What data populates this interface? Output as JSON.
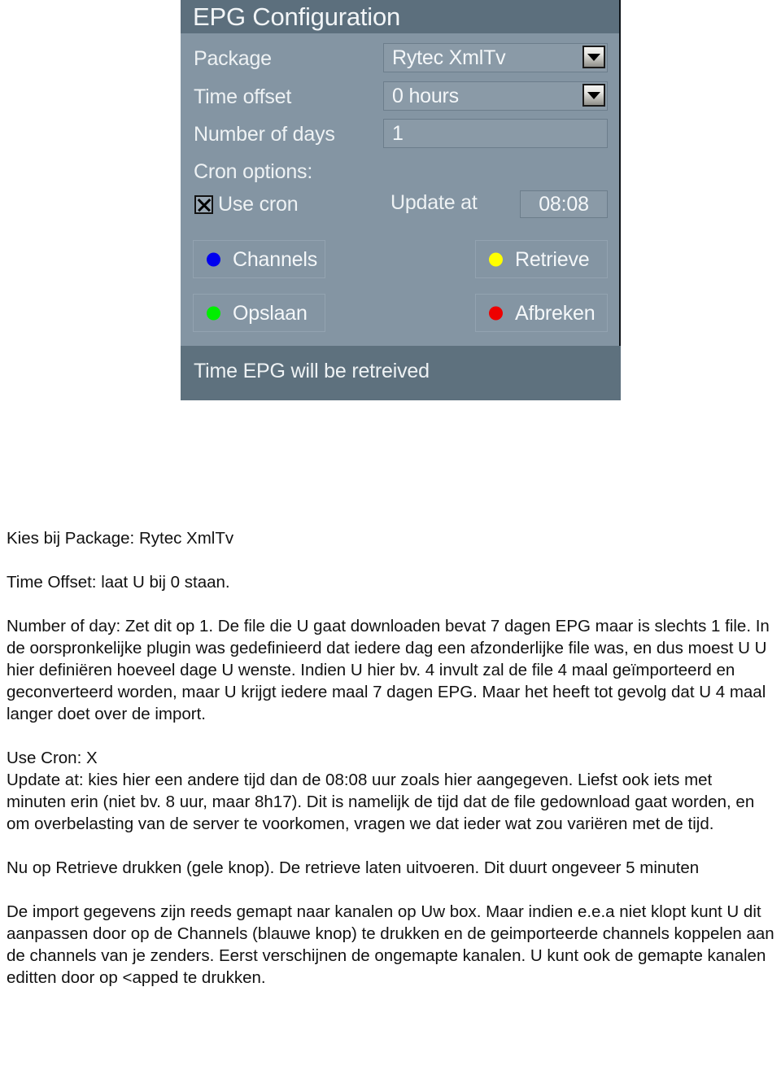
{
  "dialog": {
    "title": "EPG Configuration",
    "fields": [
      {
        "label": "Package",
        "value": "Rytec XmlTv",
        "type": "dropdown"
      },
      {
        "label": "Time offset",
        "value": "0 hours",
        "type": "dropdown"
      },
      {
        "label": "Number of days",
        "value": "1",
        "type": "textinput"
      }
    ],
    "cron_section_label": "Cron options:",
    "use_cron": {
      "label": "Use cron",
      "checked": "X"
    },
    "update_at": {
      "label": "Update at",
      "value": "08:08"
    },
    "buttons": [
      {
        "label": "Channels",
        "color": "#0000ee"
      },
      {
        "label": "Retrieve",
        "color": "#ffff00"
      },
      {
        "label": "Opslaan",
        "color": "#00ee00"
      },
      {
        "label": "Afbreken",
        "color": "#ee0000"
      }
    ],
    "statusbar": "Time EPG will be retreived",
    "colors": {
      "titlebar": "#5c6f7d",
      "body": "#8495a3",
      "statusbar": "#5e717e",
      "text": "#eef2f4"
    }
  },
  "document": {
    "line_package": "Kies bij Package: Rytec XmlTv",
    "line_offset": "Time Offset: laat U bij 0 staan.",
    "para_days": "Number of day: Zet dit op 1.  De file die U gaat downloaden bevat 7 dagen EPG maar is slechts 1 file.  In de oorspronkelijke plugin was gedefinieerd dat iedere dag een afzonderlijke file was, en dus moest U U hier definiëren hoeveel dage U wenste. Indien U hier bv. 4 invult zal de file 4 maal geïmporteerd en geconverteerd worden, maar U krijgt iedere maal 7 dagen EPG.  Maar het heeft tot gevolg dat U 4 maal langer doet over de import.",
    "line_usecron": "Use Cron: X",
    "para_update": "Update at:  kies hier een andere tijd dan de 08:08 uur zoals hier aangegeven.  Liefst ook iets met minuten erin (niet bv. 8 uur, maar 8h17).  Dit is namelijk de tijd dat de file gedownload gaat worden, en om overbelasting van de server te voorkomen, vragen we dat ieder wat zou variëren met de tijd.",
    "para_retrieve": "Nu op Retrieve drukken (gele knop). De retrieve laten uitvoeren.  Dit duurt ongeveer 5 minuten",
    "para_import": "De import gegevens zijn reeds gemapt naar kanalen op Uw box.  Maar indien e.e.a niet klopt kunt U dit aanpassen door op de Channels (blauwe knop) te drukken en de geimporteerde channels koppelen aan de channels van je zenders.   Eerst verschijnen de ongemapte kanalen.  U kunt ook de gemapte kanalen editten door op <apped te drukken."
  }
}
